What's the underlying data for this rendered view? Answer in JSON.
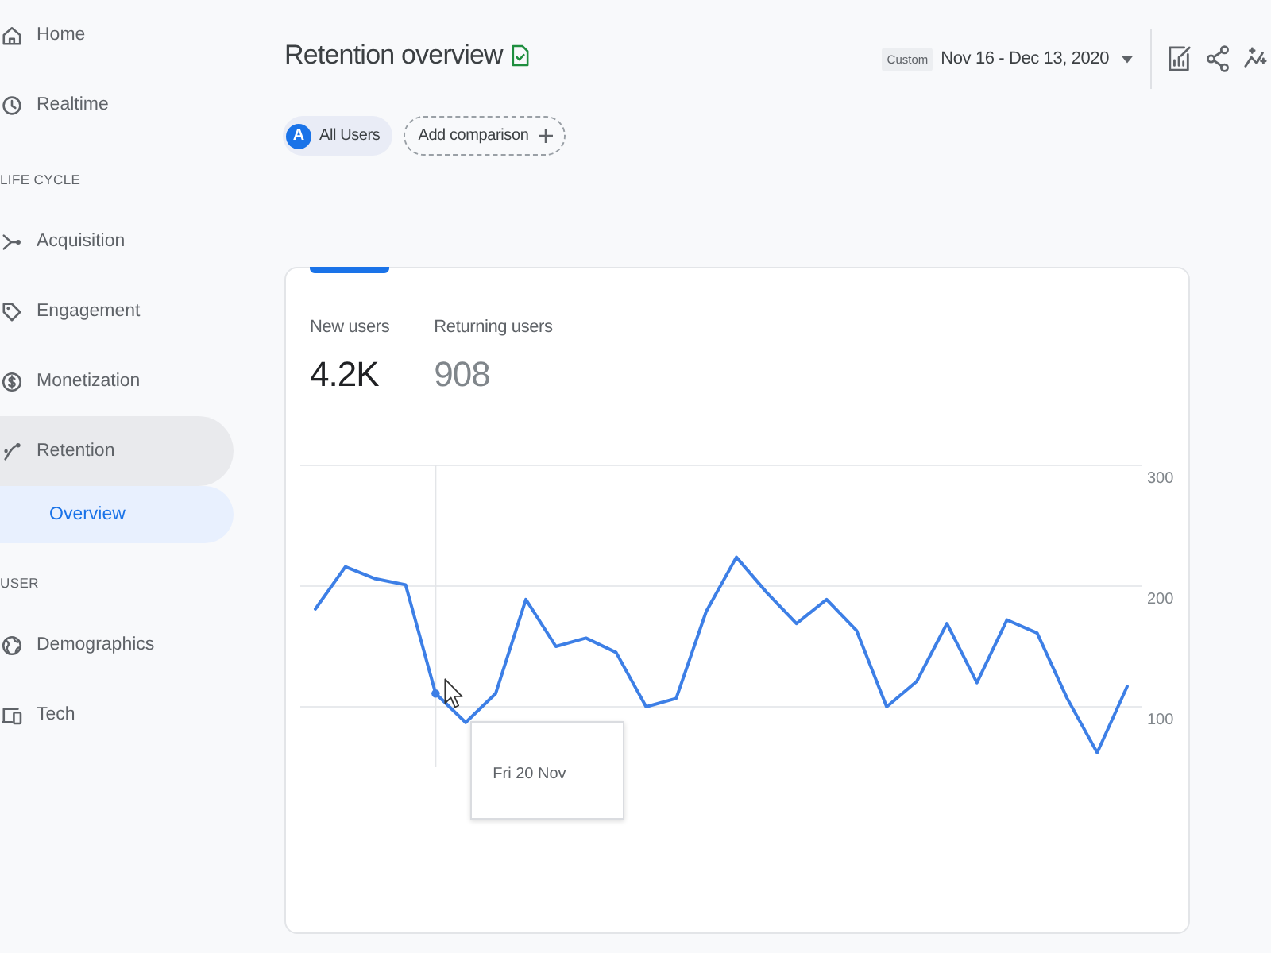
{
  "sidebar": [
    {
      "kind": "item",
      "label": "Home",
      "expanded": false
    },
    {
      "kind": "item",
      "label": "Realtime",
      "expanded": false
    },
    {
      "kind": "section",
      "label": "LIFE CYCLE"
    },
    {
      "kind": "item",
      "label": "Acquisition",
      "expanded": false
    },
    {
      "kind": "item",
      "label": "Engagement",
      "expanded": false
    },
    {
      "kind": "item",
      "label": "Monetization",
      "expanded": false
    },
    {
      "kind": "item",
      "label": "Retention",
      "expanded": true,
      "children": [
        {
          "label": "Overview",
          "selected": true
        }
      ]
    },
    {
      "kind": "section",
      "label": "USER"
    },
    {
      "kind": "item",
      "label": "Demographics",
      "expanded": false
    },
    {
      "kind": "item",
      "label": "Tech",
      "expanded": false
    }
  ],
  "header": {
    "title": "Retention overview",
    "date_preset": "Custom",
    "date_range": "Nov 16 - Dec 13, 2020"
  },
  "comparisons": [
    {
      "kind": "segment",
      "avatar": "A",
      "label": "All Users"
    },
    {
      "kind": "add",
      "label": "Add comparison"
    }
  ],
  "card": {
    "tabs": [
      {
        "label": "New users",
        "value": "4.2K",
        "selected": true
      },
      {
        "label": "Returning users",
        "value": "908",
        "selected": false
      }
    ],
    "chart_data": {
      "type": "line",
      "ylim": [
        50,
        300
      ],
      "yticks": [
        100,
        200,
        300
      ],
      "series": [
        {
          "color": "#3d7fe6",
          "values": [
            181,
            216,
            206,
            201,
            111,
            87,
            111,
            189,
            150,
            157,
            145,
            100,
            107,
            179,
            224,
            195,
            169,
            189,
            163,
            100,
            121,
            169,
            120,
            172,
            161,
            107,
            62,
            117
          ]
        }
      ],
      "annotations": [
        "Fri 20 Nov"
      ]
    }
  }
}
